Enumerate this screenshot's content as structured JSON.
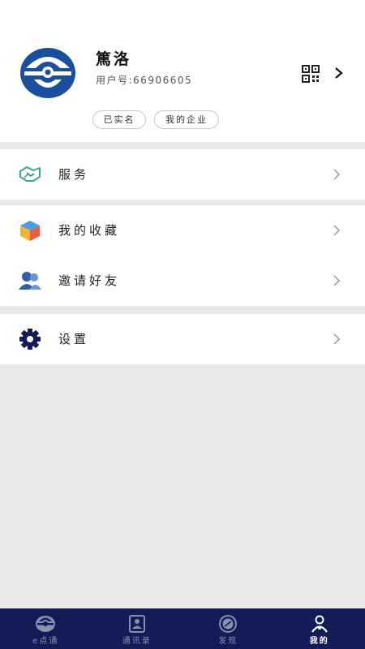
{
  "profile": {
    "name": "篤洛",
    "user_id": "用户号:66906605",
    "tags": [
      "已实名",
      "我的企业"
    ]
  },
  "menu": {
    "services": {
      "label": "服务",
      "icon": "handshake-icon"
    },
    "favorites": {
      "label": "我的收藏",
      "icon": "cube-icon"
    },
    "invite": {
      "label": "邀请好友",
      "icon": "people-icon"
    },
    "settings": {
      "label": "设置",
      "icon": "gear-icon"
    }
  },
  "tabs": [
    {
      "label": "e点通",
      "icon": "e-logo-icon",
      "active": false
    },
    {
      "label": "通讯录",
      "icon": "contacts-icon",
      "active": false
    },
    {
      "label": "发现",
      "icon": "discover-icon",
      "active": false
    },
    {
      "label": "我的",
      "icon": "person-icon",
      "active": true
    }
  ],
  "colors": {
    "brand_navy": "#141c58",
    "avatar_blue": "#1a4fa0",
    "service_green": "#3aa58a",
    "background": "#e9e9e9"
  }
}
